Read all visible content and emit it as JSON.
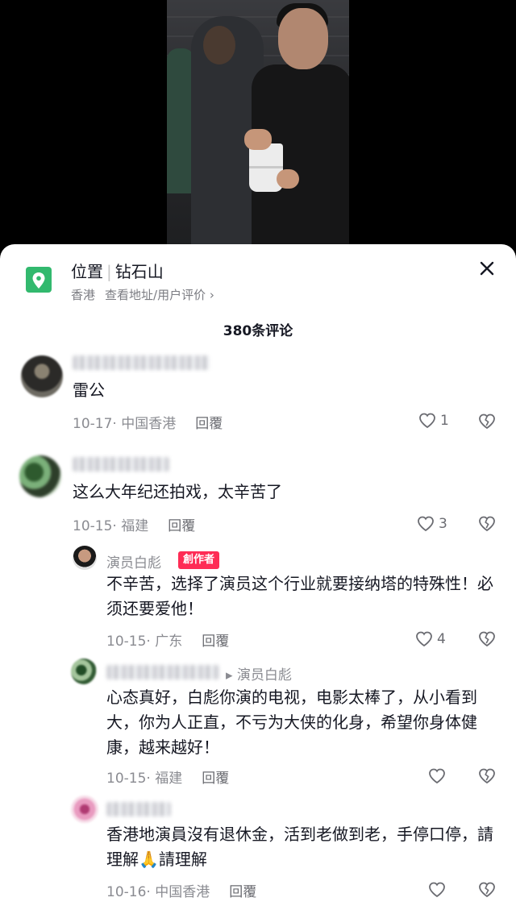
{
  "location": {
    "label": "位置",
    "separator": "|",
    "place": "钻石山",
    "region": "香港",
    "detail_link": "查看地址/用户评价 ›"
  },
  "comments_count": "380条评论",
  "comments": [
    {
      "text": "雷公",
      "date": "10-17",
      "area": "中国香港",
      "reply": "回覆",
      "likes": "1"
    },
    {
      "text": "这么大年纪还拍戏，太辛苦了",
      "date": "10-15",
      "area": "福建",
      "reply": "回覆",
      "likes": "3",
      "replies": [
        {
          "name": "演员白彪",
          "badge": "創作者",
          "text": "不辛苦，选择了演员这个行业就要接纳塔的特殊性！必须还要爱他！",
          "date": "10-15",
          "area": "广东",
          "reply": "回覆",
          "likes": "4"
        },
        {
          "reply_to": "▸ 演员白彪",
          "text": "心态真好，白彪你演的电视，电影太棒了，从小看到大，你为人正直，不亏为大侠的化身，希望你身体健康，越来越好！",
          "date": "10-15",
          "area": "福建",
          "reply": "回覆",
          "likes": ""
        },
        {
          "text": "香港地演員沒有退休金，活到老做到老，手停口停，請理解🙏請理解",
          "date": "10-16",
          "area": "中国香港",
          "reply": "回覆",
          "likes": ""
        }
      ]
    }
  ],
  "colors": {
    "accent": "#fe2c55",
    "location_icon": "#32b96e",
    "muted": "#8a8b91"
  },
  "icons": [
    "location-pin-icon",
    "close-icon",
    "heart-outline-icon",
    "broken-heart-icon"
  ]
}
